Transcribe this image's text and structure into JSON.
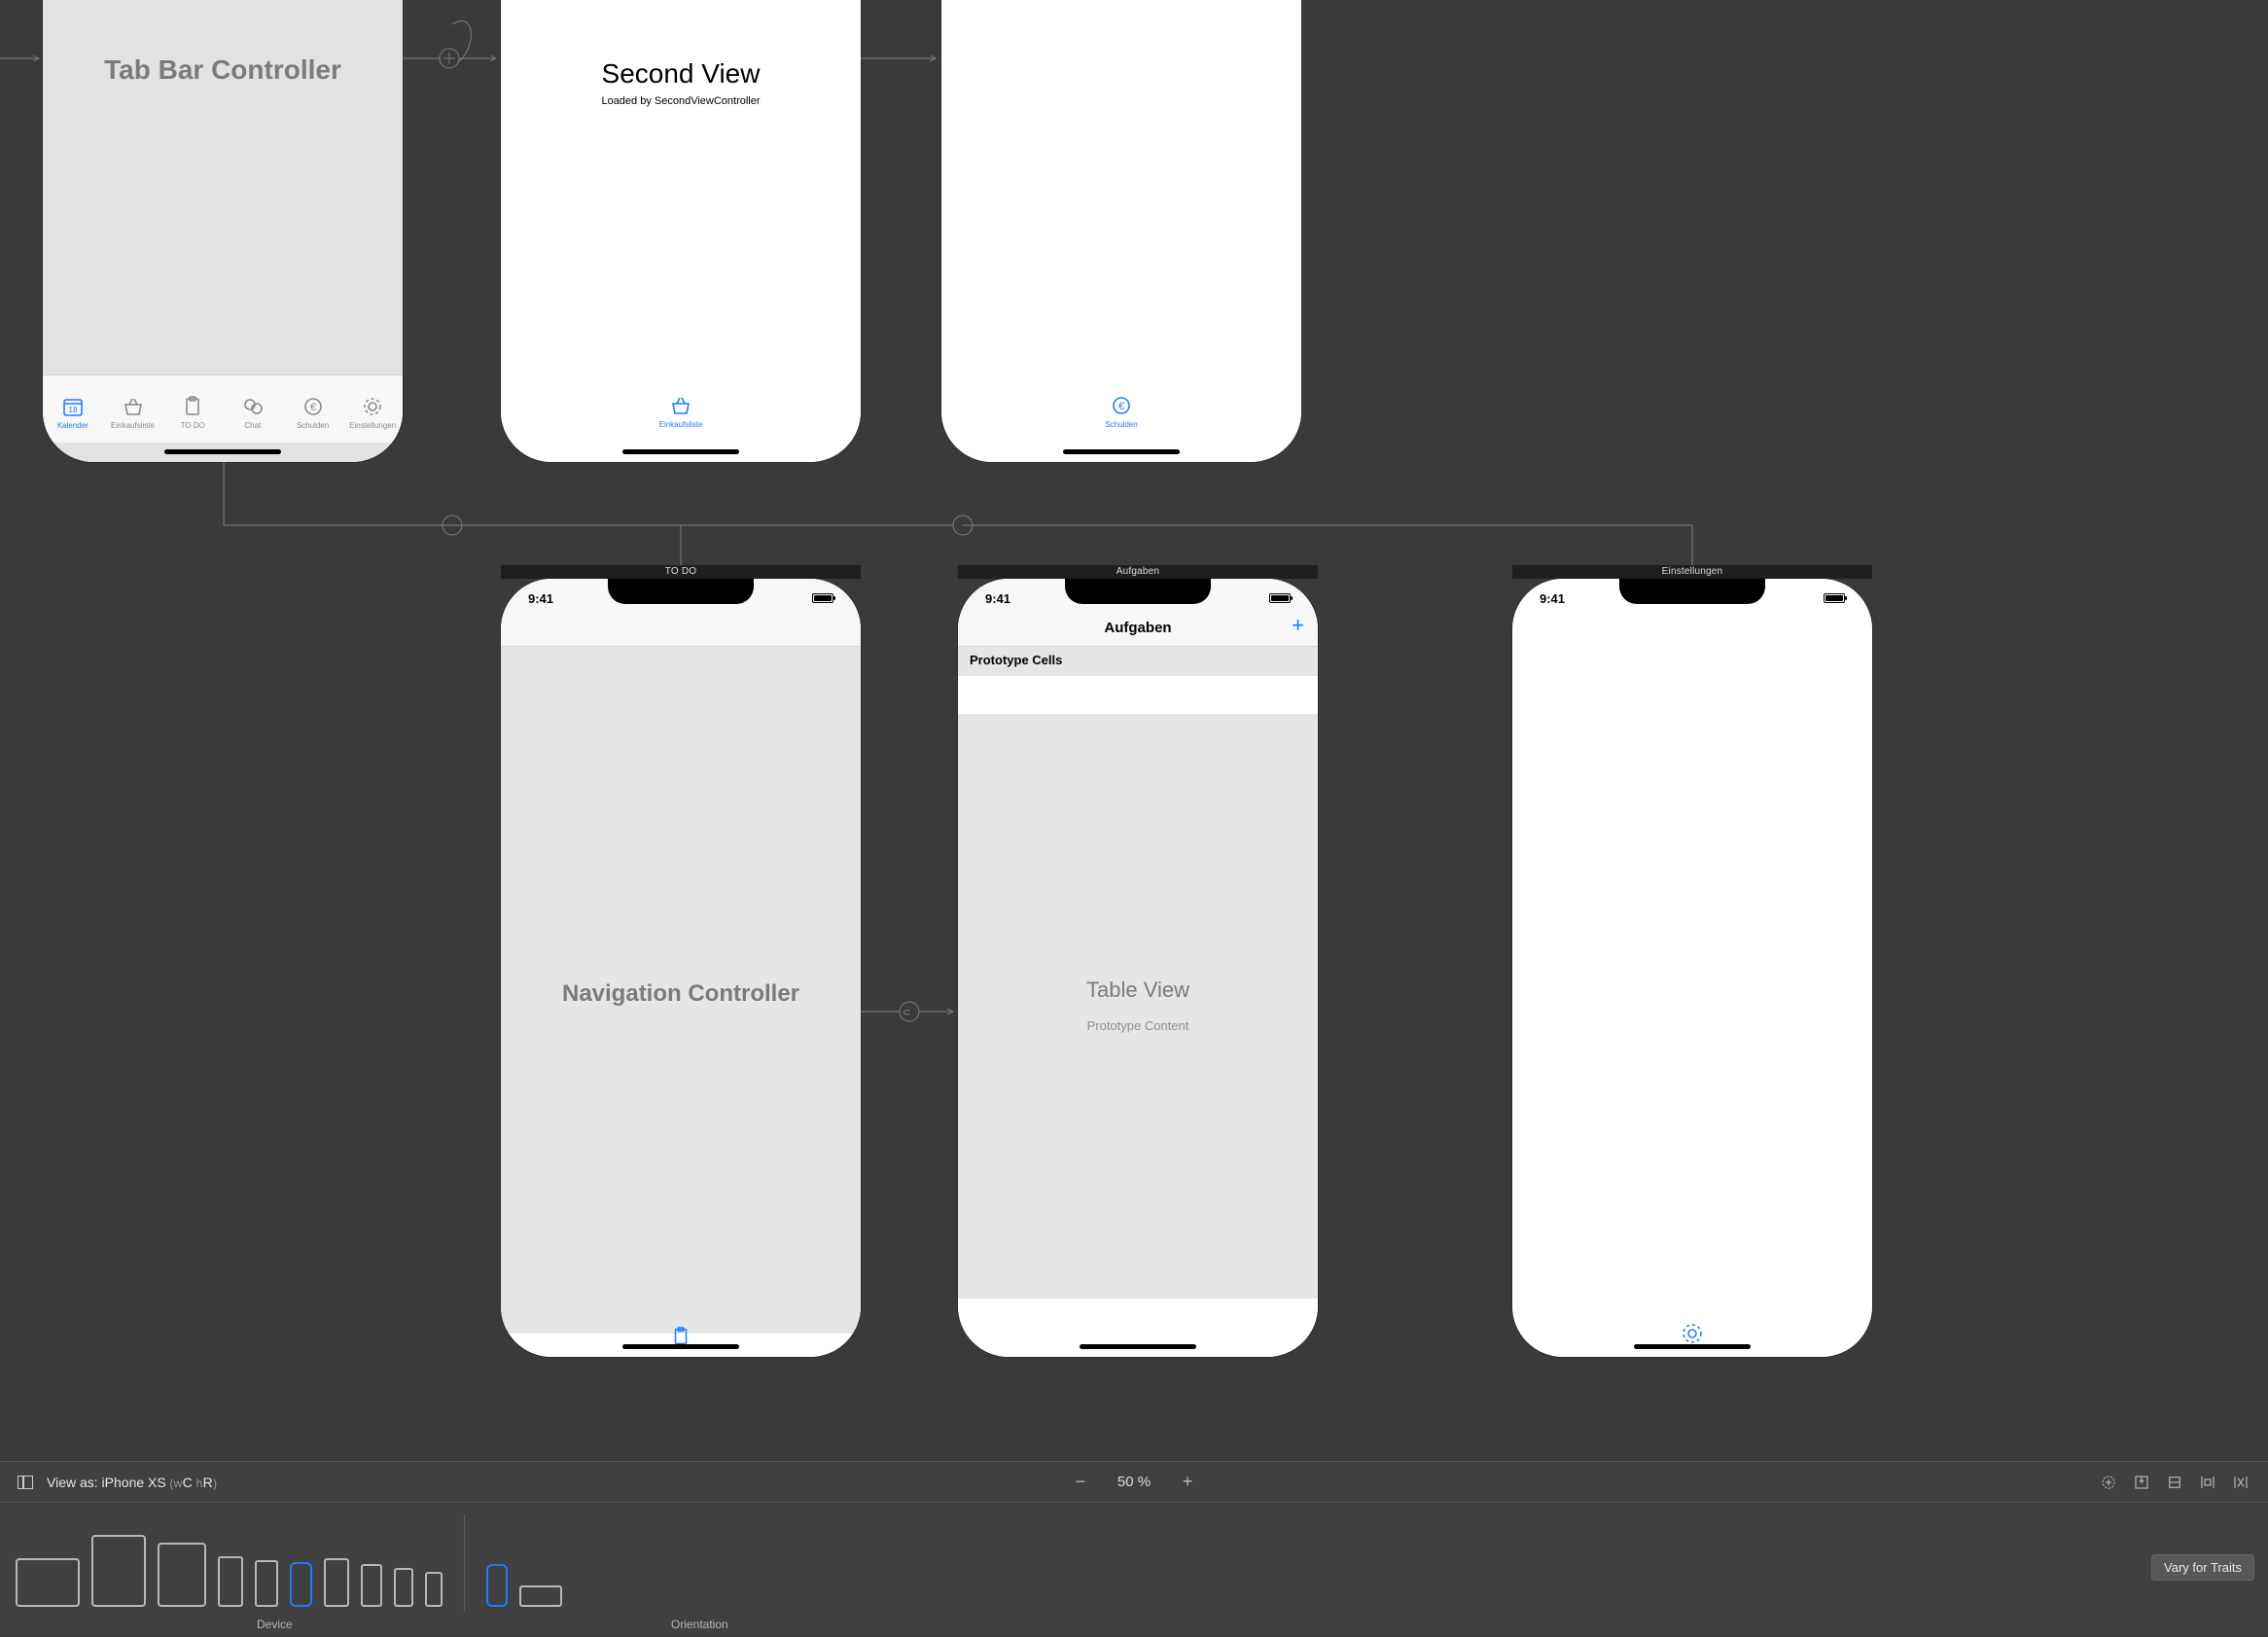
{
  "scenes": {
    "tabbar_controller": {
      "title": "Tab Bar Controller",
      "tabs": [
        {
          "label": "Kalender",
          "icon": "calendar"
        },
        {
          "label": "Einkaufsliste",
          "icon": "basket"
        },
        {
          "label": "TO DO",
          "icon": "clipboard"
        },
        {
          "label": "Chat",
          "icon": "chat"
        },
        {
          "label": "Schulden",
          "icon": "euro"
        },
        {
          "label": "Einstellungen",
          "icon": "gear"
        }
      ]
    },
    "second_view": {
      "title": "Second View",
      "subtitle": "Loaded by SecondViewController",
      "tab": {
        "label": "Einkaufsliste",
        "icon": "basket"
      }
    },
    "schulden_view": {
      "tab": {
        "label": "Schulden",
        "icon": "euro"
      }
    },
    "nav_controller": {
      "scene_label": "TO DO",
      "clock": "9:41",
      "title": "Navigation Controller",
      "bottom_icon": "clipboard"
    },
    "table_view": {
      "scene_label": "Aufgaben",
      "clock": "9:41",
      "nav_title": "Aufgaben",
      "nav_action": "+",
      "section_header": "Prototype Cells",
      "placeholder_title": "Table View",
      "placeholder_subtitle": "Prototype Content"
    },
    "settings_view": {
      "scene_label": "Einstellungen",
      "clock": "9:41",
      "bottom_icon": "gear"
    }
  },
  "bottom_bar": {
    "view_as_prefix": "View as: ",
    "view_as_device": "iPhone XS",
    "size_class_open": " (",
    "size_class_w": "w",
    "size_class_C": "C",
    "size_class_h": " h",
    "size_class_R": "R",
    "size_class_close": ")",
    "zoom_label": "50 %",
    "device_label": "Device",
    "orientation_label": "Orientation",
    "vary_button": "Vary for Traits"
  }
}
